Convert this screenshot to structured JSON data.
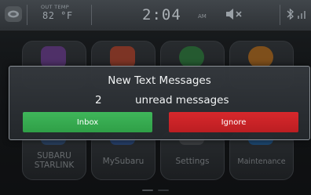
{
  "status_bar": {
    "outside_temp_label": "OUT TEMP",
    "outside_temp_value": "82 °F",
    "time": "2:04",
    "ampm": "AM",
    "icons": [
      "home-icon",
      "mute-icon",
      "bluetooth-icon",
      "signal-icon"
    ]
  },
  "apps": [
    {
      "label": "SUBARU\nSTARLINK",
      "icon": "starlink-icon",
      "color": "#3c5f8c"
    },
    {
      "label": "MySubaru",
      "icon": "mysubaru-icon",
      "color": "#3a5f9b"
    },
    {
      "label": "Settings",
      "icon": "settings-icon",
      "color": "#5a5f63"
    },
    {
      "label": "Maintenance",
      "icon": "maintenance-icon",
      "color": "#2c6aa8"
    }
  ],
  "top_apps_icons": [
    "media-icon",
    "apps-icon",
    "phone-icon",
    "grid-icon"
  ],
  "dialog": {
    "title": "New Text Messages",
    "count": "2",
    "message": "unread messages",
    "inbox_label": "Inbox",
    "ignore_label": "Ignore"
  },
  "colors": {
    "inbox": "#3fb65a",
    "ignore": "#d8282c"
  }
}
